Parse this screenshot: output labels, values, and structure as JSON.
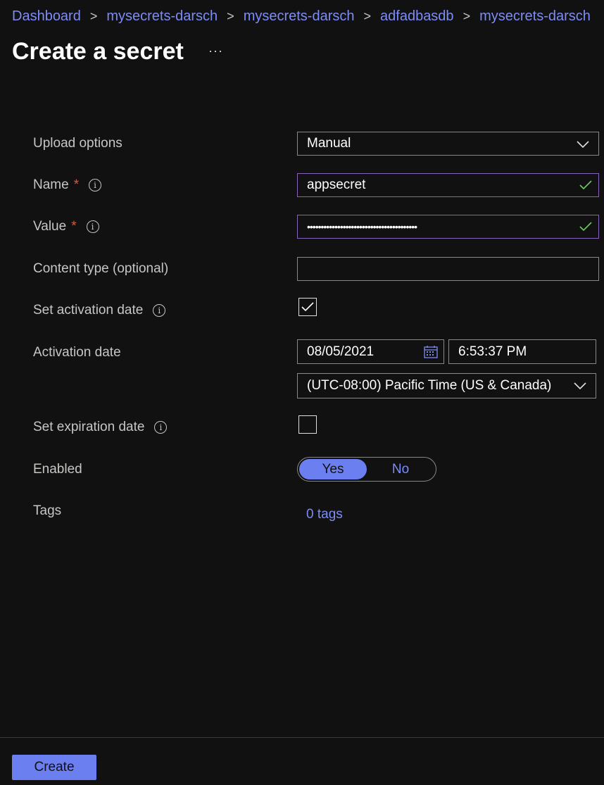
{
  "breadcrumb": [
    "Dashboard",
    "mysecrets-darsch",
    "mysecrets-darsch",
    "adfadbasdb",
    "mysecrets-darsch"
  ],
  "page": {
    "title": "Create a secret",
    "more_label": "···"
  },
  "form": {
    "upload_options": {
      "label": "Upload options",
      "value": "Manual"
    },
    "name": {
      "label": "Name",
      "required_mark": "*",
      "value": "appsecret"
    },
    "value": {
      "label": "Value",
      "required_mark": "*",
      "value": "••••••••••••••••••••••••••••••••••••••••"
    },
    "content_type": {
      "label": "Content type (optional)",
      "value": ""
    },
    "set_activation_date": {
      "label": "Set activation date",
      "checked": true
    },
    "activation_date": {
      "label": "Activation date",
      "date": "08/05/2021",
      "time": "6:53:37 PM",
      "timezone": "(UTC-08:00) Pacific Time (US & Canada)"
    },
    "set_expiration_date": {
      "label": "Set expiration date",
      "checked": false
    },
    "enabled": {
      "label": "Enabled",
      "yes_label": "Yes",
      "no_label": "No",
      "selected": "Yes"
    },
    "tags": {
      "label": "Tags",
      "link": "0 tags"
    }
  },
  "footer": {
    "create_label": "Create"
  },
  "colors": {
    "accent": "#6b7ff0",
    "link": "#7c8cf8",
    "valid_check": "#6ccb5f",
    "required": "#e0583c",
    "background": "#111111"
  },
  "icons": {
    "info": "info-icon",
    "chevron": "chevron-down-icon",
    "check": "check-icon",
    "calendar": "calendar-icon",
    "breadcrumb_separator": "chevron-right-icon"
  }
}
